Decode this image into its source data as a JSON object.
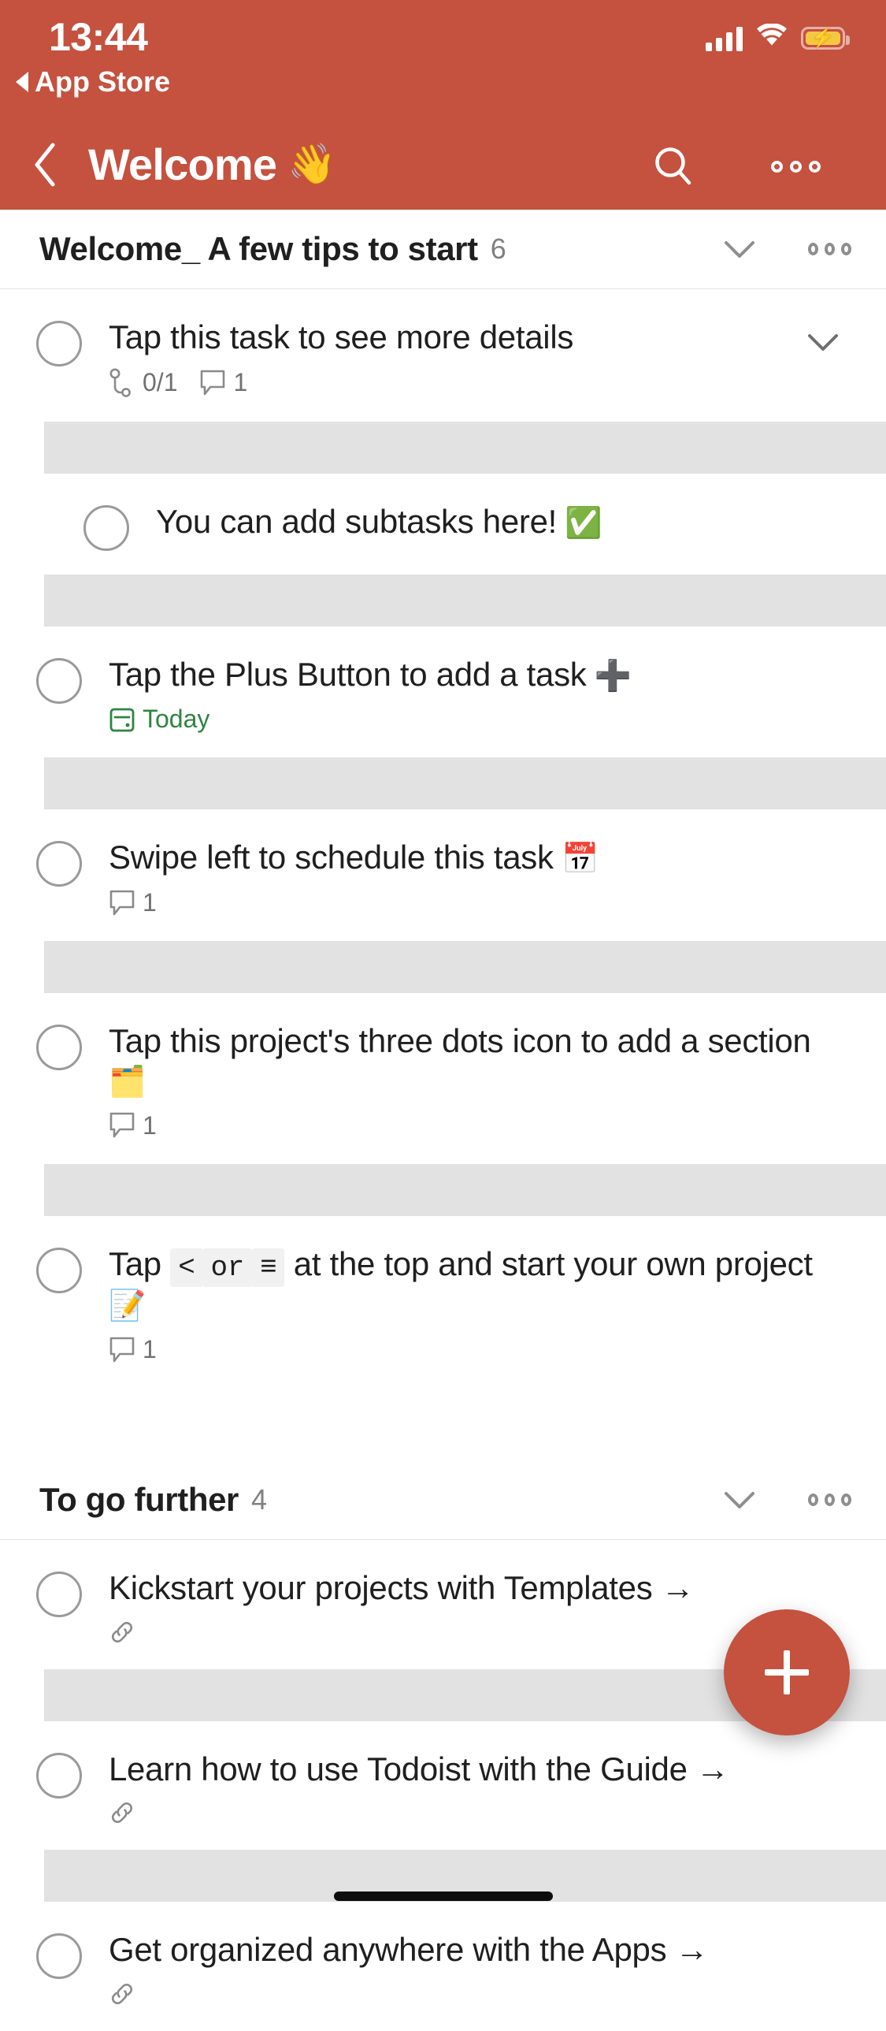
{
  "status_bar": {
    "time": "13:44",
    "back_label": "App Store",
    "signal_icon": "cellular-bars-icon",
    "wifi_icon": "wifi-icon",
    "battery_icon": "battery-charging-icon"
  },
  "nav": {
    "back_icon": "chevron-left-icon",
    "title": "Welcome",
    "title_emoji": "👋",
    "search_icon": "search-icon",
    "more_icon": "more-options-icon"
  },
  "theme": {
    "accent": "#c5513f",
    "text": "#1f1f1f",
    "muted": "#707070",
    "due_green": "#2e8540",
    "divider": "#e2e2e2"
  },
  "sections": [
    {
      "title": "Welcome_ A few tips to start",
      "count": "6",
      "collapse_icon": "chevron-down-icon",
      "more_icon": "more-options-icon",
      "tasks": [
        {
          "text": "Tap this task to see more details",
          "emoji": "",
          "sub": false,
          "chevron": true,
          "meta": [
            {
              "icon": "subtask-icon",
              "text": "0/1"
            },
            {
              "icon": "comment-icon",
              "text": "1"
            }
          ]
        },
        {
          "text": "You can add subtasks here!",
          "emoji": "✅",
          "sub": true,
          "chevron": false,
          "meta": []
        },
        {
          "text": "Tap the Plus Button to add a task",
          "emoji": "➕",
          "sub": false,
          "chevron": false,
          "meta": [
            {
              "icon": "calendar-icon",
              "text": "Today",
              "color": "#2e8540"
            }
          ]
        },
        {
          "text": "Swipe left to schedule this task",
          "emoji": "📅",
          "sub": false,
          "chevron": false,
          "meta": [
            {
              "icon": "comment-icon",
              "text": "1"
            }
          ]
        },
        {
          "text": "Tap this project's three dots icon to add a section",
          "emoji": "🗂️",
          "sub": false,
          "chevron": false,
          "meta": [
            {
              "icon": "comment-icon",
              "text": "1"
            }
          ]
        },
        {
          "text_parts": [
            {
              "type": "plain",
              "value": "Tap "
            },
            {
              "type": "code",
              "value": "<"
            },
            {
              "type": "code",
              "value": "or"
            },
            {
              "type": "code",
              "value": "≡"
            },
            {
              "type": "plain",
              "value": " at the top and start your own project "
            }
          ],
          "text": "Tap < or ≡ at the top and start your own project",
          "emoji": "📝",
          "sub": false,
          "chevron": false,
          "meta": [
            {
              "icon": "comment-icon",
              "text": "1"
            }
          ]
        }
      ]
    },
    {
      "title": "To go further",
      "count": "4",
      "collapse_icon": "chevron-down-icon",
      "more_icon": "more-options-icon",
      "tasks": [
        {
          "text": "Kickstart your projects with Templates →",
          "emoji": "",
          "sub": false,
          "chevron": false,
          "meta": [
            {
              "icon": "link-icon",
              "text": ""
            }
          ]
        },
        {
          "text": "Learn how to use Todoist with the Guide →",
          "emoji": "",
          "sub": false,
          "chevron": false,
          "meta": [
            {
              "icon": "link-icon",
              "text": ""
            }
          ]
        },
        {
          "text": "Get organized anywhere with the Apps →",
          "emoji": "",
          "sub": false,
          "chevron": false,
          "meta": [
            {
              "icon": "link-icon",
              "text": ""
            }
          ]
        }
      ]
    }
  ],
  "fab": {
    "label": "+",
    "icon": "plus-icon"
  },
  "home_indicator": "home-indicator"
}
